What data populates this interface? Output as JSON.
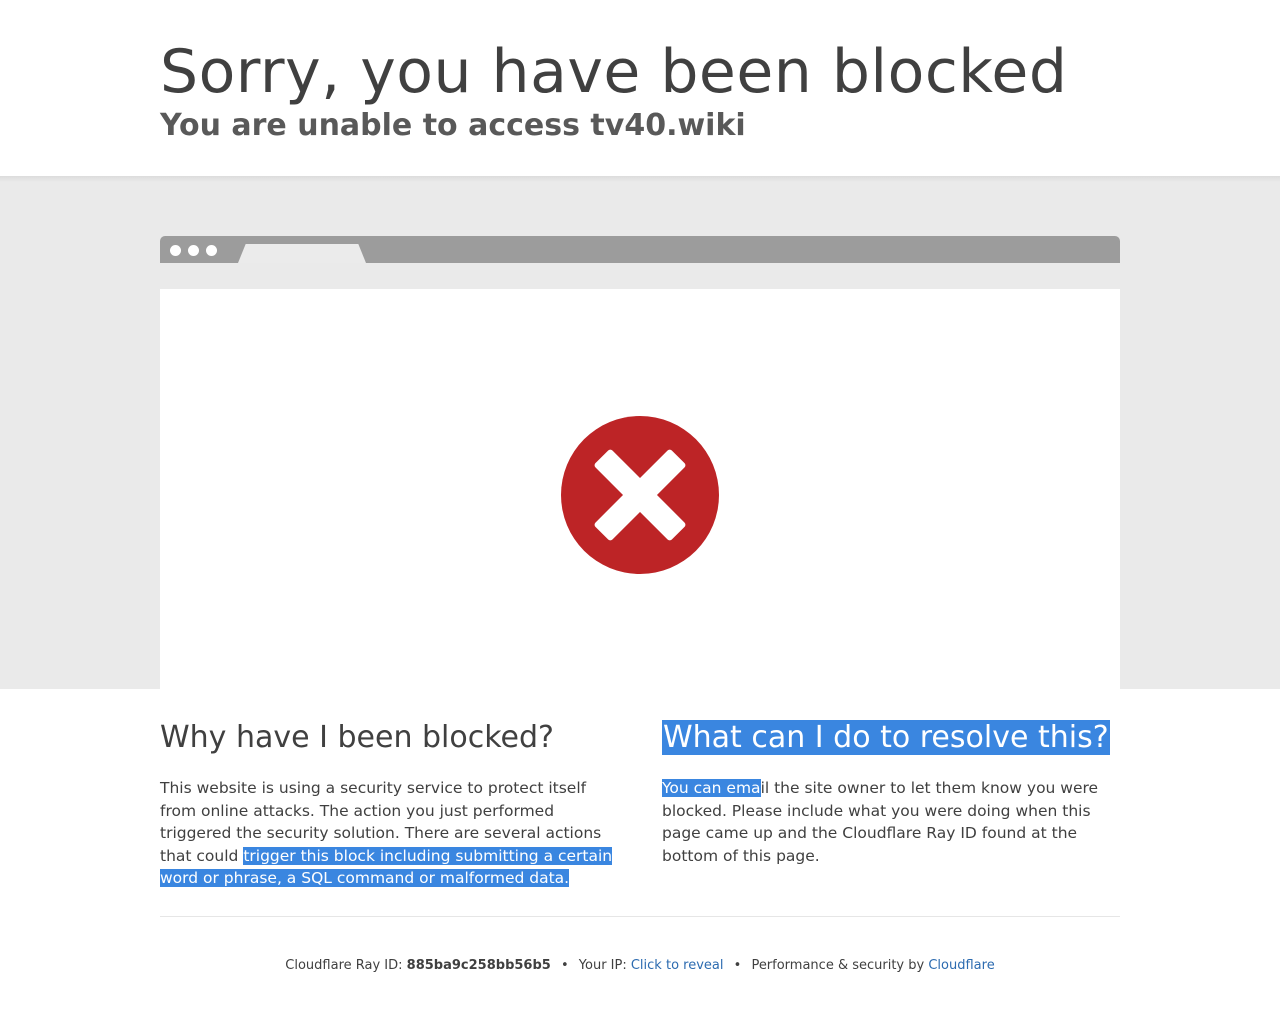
{
  "header": {
    "title": "Sorry, you have been blocked",
    "subtitle": "You are unable to access tv40.wiki"
  },
  "illustration": {
    "icon": "error-x-circle-icon",
    "colors": {
      "circle": "#bd2426",
      "band": "#eaeaea",
      "chrome": "#9c9c9c"
    }
  },
  "why": {
    "heading": "Why have I been blocked?",
    "text_plain": "This website is using a security service to protect itself from online attacks. The action you just performed triggered the security solution. There are several actions that could",
    "text_selected": "trigger this block including submitting a certain word or phrase, a SQL command or malformed data."
  },
  "resolve": {
    "heading": "What can I do to resolve this?",
    "text_selected": "You can ema",
    "text_plain": "il the site owner to let them know you were blocked. Please include what you were doing when this page came up and the Cloudflare Ray ID found at the bottom of this page."
  },
  "footer": {
    "ray_label": "Cloudflare Ray ID:",
    "ray_id": "885ba9c258bb56b5",
    "separator": "•",
    "ip_label": "Your IP:",
    "ip_link": "Click to reveal",
    "perf_label": "Performance & security by",
    "cloudflare_link": "Cloudflare",
    "link_color": "#2c6bb0",
    "selection_color": "#3a86e0"
  }
}
